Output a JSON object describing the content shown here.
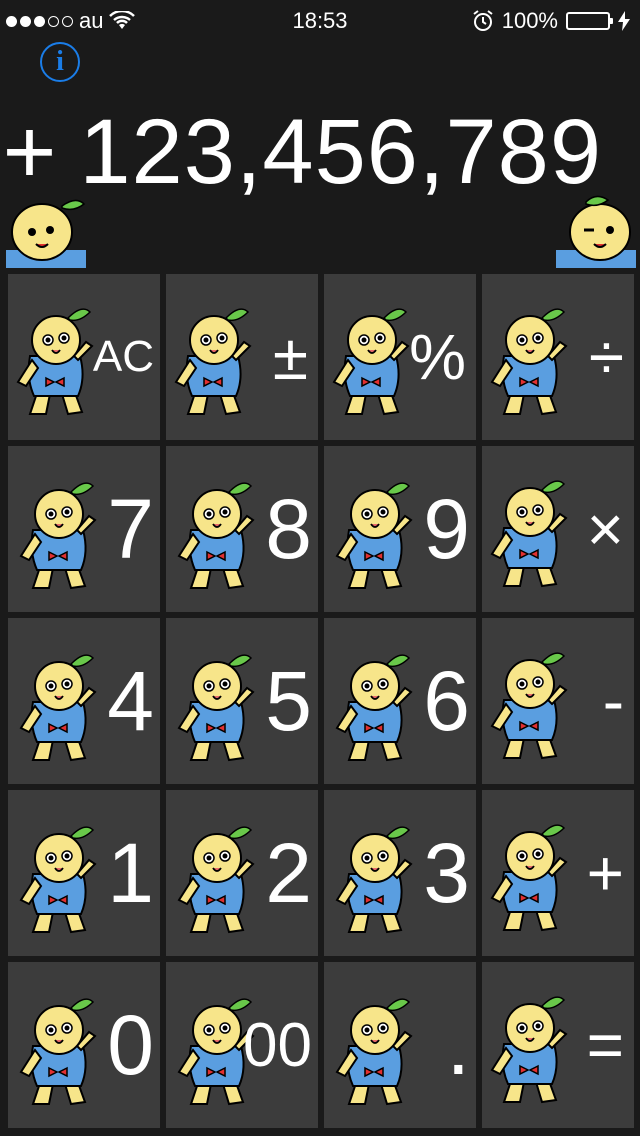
{
  "status_bar": {
    "carrier": "au",
    "time": "18:53",
    "battery": "100%",
    "signal_icon": "signal-dots-icon",
    "wifi_icon": "wifi-icon",
    "alarm_icon": "alarm-clock-icon",
    "battery_icon": "battery-icon",
    "charging_icon": "charging-bolt-icon",
    "battery_color": "#4cd964"
  },
  "info_button": {
    "label": "i",
    "color": "#1a7de8"
  },
  "display": {
    "sign": "+",
    "value": "123,456,789"
  },
  "keys": [
    {
      "id": "ac",
      "label": "AC"
    },
    {
      "id": "sign",
      "label": "±"
    },
    {
      "id": "percent",
      "label": "%"
    },
    {
      "id": "divide",
      "label": "÷"
    },
    {
      "id": "7",
      "label": "7"
    },
    {
      "id": "8",
      "label": "8"
    },
    {
      "id": "9",
      "label": "9"
    },
    {
      "id": "multiply",
      "label": "×"
    },
    {
      "id": "4",
      "label": "4"
    },
    {
      "id": "5",
      "label": "5"
    },
    {
      "id": "6",
      "label": "6"
    },
    {
      "id": "minus",
      "label": "-"
    },
    {
      "id": "1",
      "label": "1"
    },
    {
      "id": "2",
      "label": "2"
    },
    {
      "id": "3",
      "label": "3"
    },
    {
      "id": "plus",
      "label": "+"
    },
    {
      "id": "0",
      "label": "0"
    },
    {
      "id": "00",
      "label": "00"
    },
    {
      "id": "decimal",
      "label": "."
    },
    {
      "id": "equals",
      "label": "="
    }
  ],
  "colors": {
    "background": "#1a1a1a",
    "key": "#3c3c3c",
    "mascot_body": "#f7e58a",
    "mascot_shirt": "#5a9ee0",
    "mascot_bow": "#e23030",
    "leaf": "#69c84a"
  }
}
